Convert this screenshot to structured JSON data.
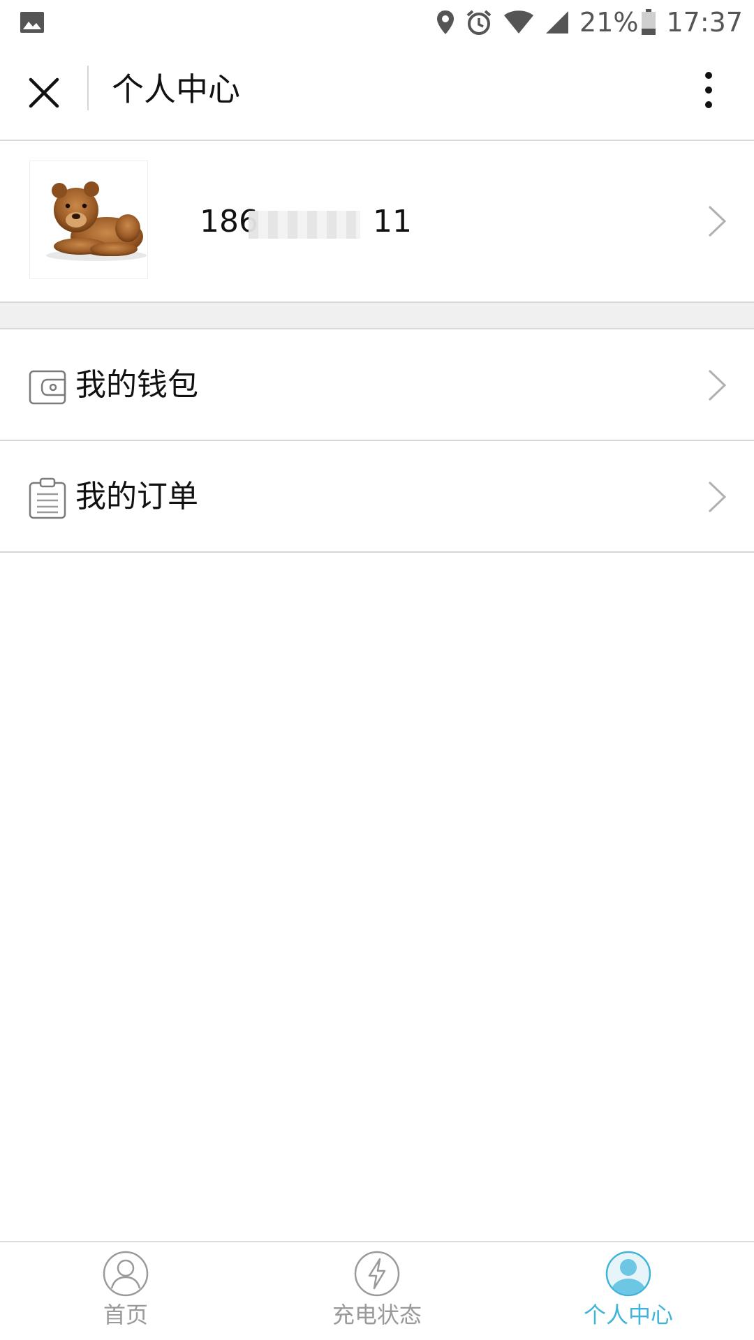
{
  "status_bar": {
    "battery": "21%",
    "time": "17:37",
    "icons": [
      "image-icon",
      "location-icon",
      "alarm-icon",
      "wifi-icon",
      "signal-icon",
      "battery-icon"
    ]
  },
  "header": {
    "title": "个人中心"
  },
  "profile": {
    "phone_visible_prefix": "186",
    "phone_visible_suffix": "11",
    "avatar": "teddy-bear-avatar"
  },
  "menu": [
    {
      "label": "我的钱包",
      "icon": "wallet-icon"
    },
    {
      "label": "我的订单",
      "icon": "clipboard-icon"
    }
  ],
  "bottom_nav": [
    {
      "label": "首页",
      "icon": "user-circle-icon",
      "active": false
    },
    {
      "label": "充电状态",
      "icon": "lightning-icon",
      "active": false
    },
    {
      "label": "个人中心",
      "icon": "user-filled-icon",
      "active": true
    }
  ],
  "colors": {
    "active": "#3fb4d8",
    "inactive": "#9a9a9a",
    "divider": "#d6d6d6"
  }
}
